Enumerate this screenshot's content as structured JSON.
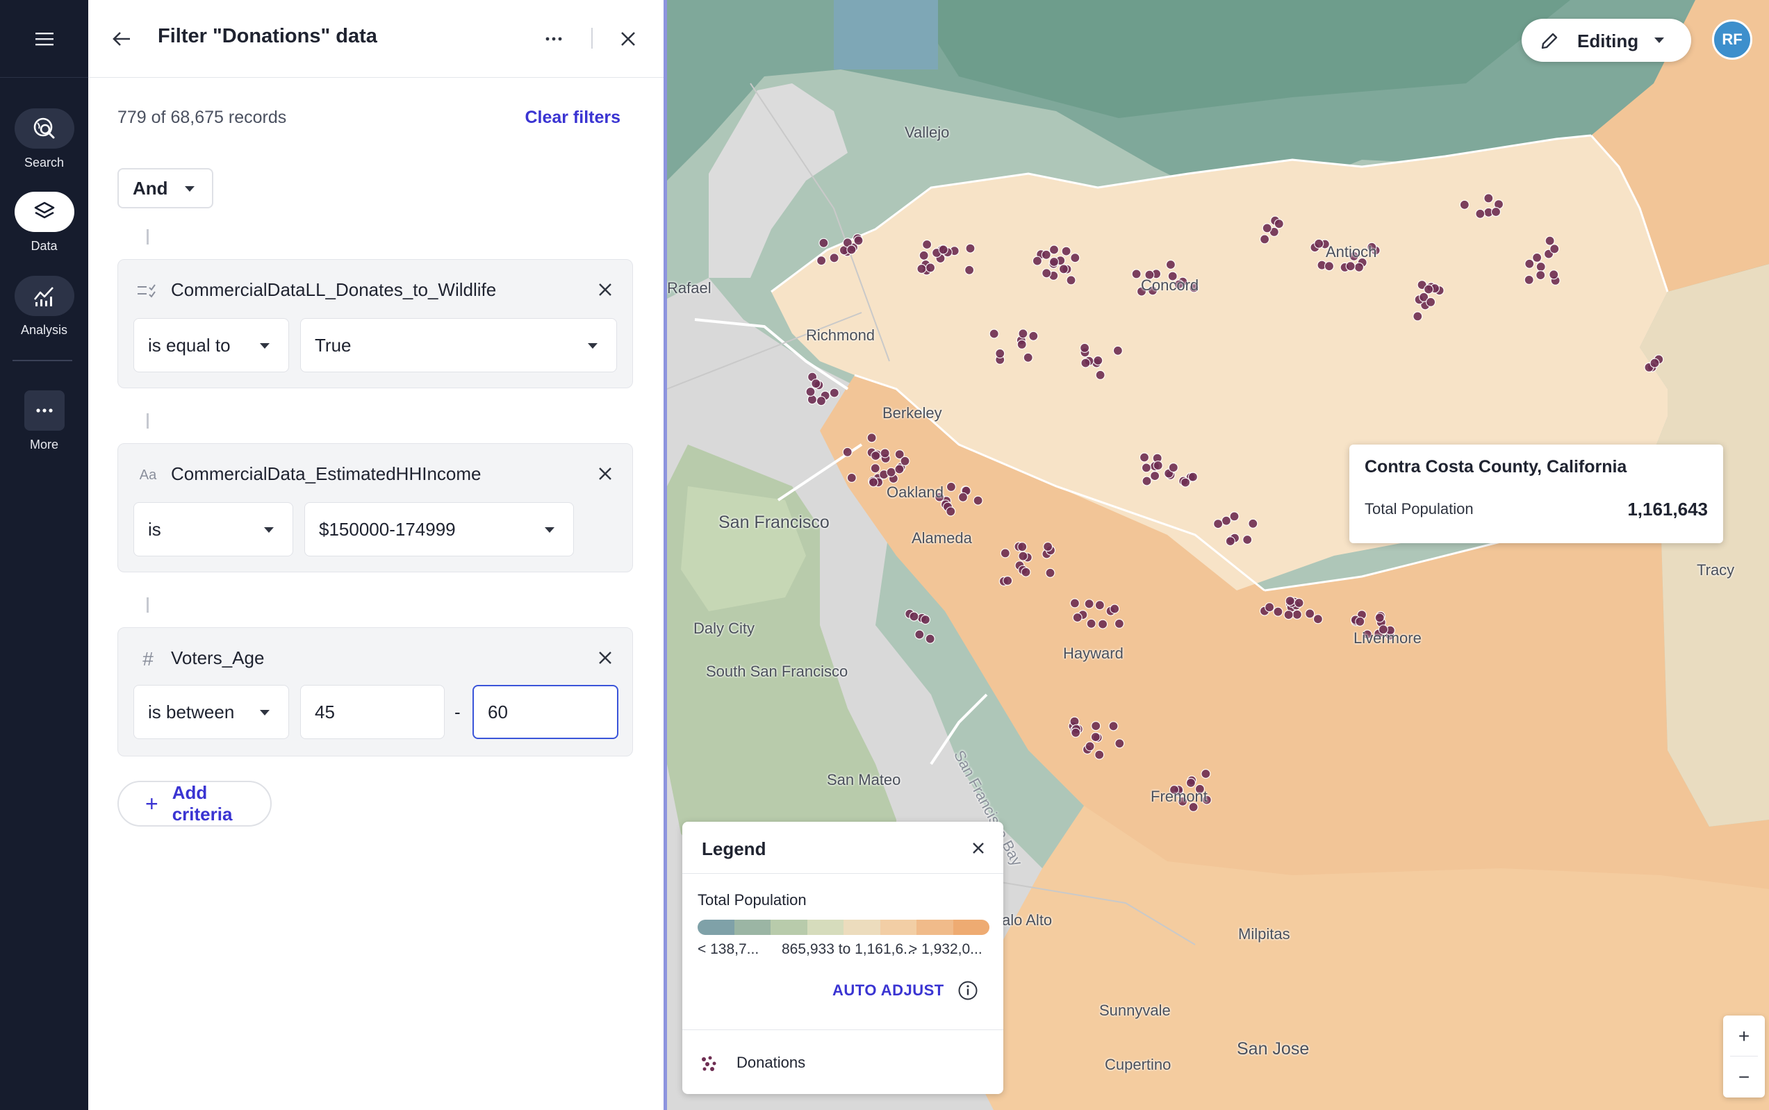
{
  "rail": {
    "items": [
      {
        "label": "Search",
        "icon": "search-globe-icon"
      },
      {
        "label": "Data",
        "icon": "layers-icon"
      },
      {
        "label": "Analysis",
        "icon": "chart-icon"
      },
      {
        "label": "More",
        "icon": "more-horizontal-icon"
      }
    ]
  },
  "panel": {
    "title": "Filter \"Donations\" data",
    "record_count": "779 of 68,675 records",
    "clear_filters": "Clear filters",
    "logic": "And",
    "filters": [
      {
        "type_icon": "boolean-icon",
        "type_glyph": "",
        "field": "CommercialDataLL_Donates_to_Wildlife",
        "operator": "is equal to",
        "value": "True"
      },
      {
        "type_icon": "text-type-icon",
        "type_glyph": "Aa",
        "field": "CommercialData_EstimatedHHIncome",
        "operator": "is",
        "value": "$150000-174999"
      },
      {
        "type_icon": "number-type-icon",
        "type_glyph": "#",
        "field": "Voters_Age",
        "operator": "is between",
        "value_min": "45",
        "range_separator": "-",
        "value_max": "60"
      }
    ],
    "add_criteria": "Add criteria"
  },
  "map": {
    "mode": "Editing",
    "user_initials": "RF",
    "cities": [
      "Vallejo",
      "Rafael",
      "Antioch",
      "Concord",
      "Richmond",
      "Berkeley",
      "Oakland",
      "San Francisco",
      "Alameda",
      "Daly City",
      "Hayward",
      "Livermore",
      "South San Francisco",
      "Tracy",
      "San Mateo",
      "Fremont",
      "San Francisco Bay",
      "alo Alto",
      "Milpitas",
      "Sunnyvale",
      "San Jose",
      "Cupertino"
    ],
    "popup": {
      "title": "Contra Costa County, California",
      "label": "Total Population",
      "value": "1,161,643"
    },
    "legend": {
      "title": "Legend",
      "layer": "Total Population",
      "ramp_colors": [
        "#7fa1a8",
        "#9bb5a4",
        "#b8cbab",
        "#d6dcbc",
        "#ecdcbd",
        "#f2cea5",
        "#f0bb8a",
        "#eeab72"
      ],
      "range_low": "< 138,7...",
      "range_mid": "865,933 to 1,161,6...",
      "range_high": "> 1,932,0...",
      "auto_adjust": "AUTO ADJUST",
      "points_layer": "Donations"
    },
    "zoom_in": "+",
    "zoom_out": "−",
    "colors": {
      "accent": "#3a34d2",
      "point": "#6e2e52",
      "contra_costa": "#f7e3c7",
      "alameda": "#f2c597",
      "santa_clara": "#f4cc9f"
    }
  }
}
